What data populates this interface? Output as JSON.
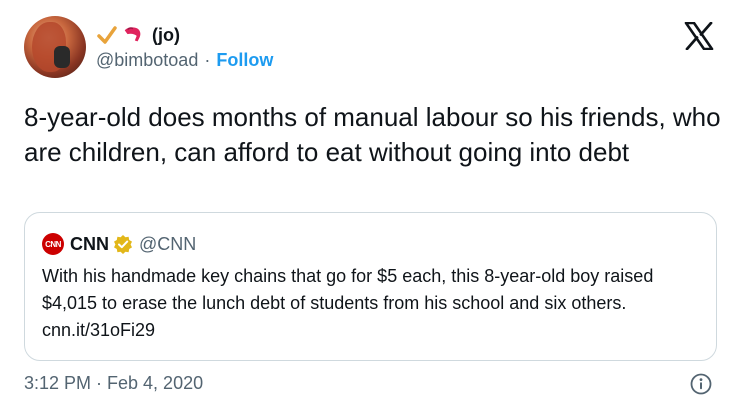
{
  "author": {
    "display_name": "(jo)",
    "handle": "@bimbotoad",
    "separator": "·",
    "follow_label": "Follow",
    "emoji_icons": [
      "check-mark-icon",
      "flexed-arm-icon"
    ]
  },
  "tweet": {
    "text": "8-year-old does months of manual labour so his friends, who are children, can afford to eat without going into debt"
  },
  "quoted_tweet": {
    "logo_text": "CNN",
    "display_name": "CNN",
    "handle": "@CNN",
    "text": "With his handmade key chains that go for $5 each, this 8-year-old boy raised $4,015 to erase the lunch debt of students from his school and six others. cnn.it/31oFi29"
  },
  "timestamp": "3:12 PM · Feb 4, 2020",
  "colors": {
    "accent": "#1d9bf0",
    "secondary_text": "#536471",
    "cnn_red": "#cc0000",
    "verified_gold": "#e2b719"
  },
  "icons": [
    "x-logo-icon",
    "verified-badge-icon",
    "info-icon"
  ]
}
